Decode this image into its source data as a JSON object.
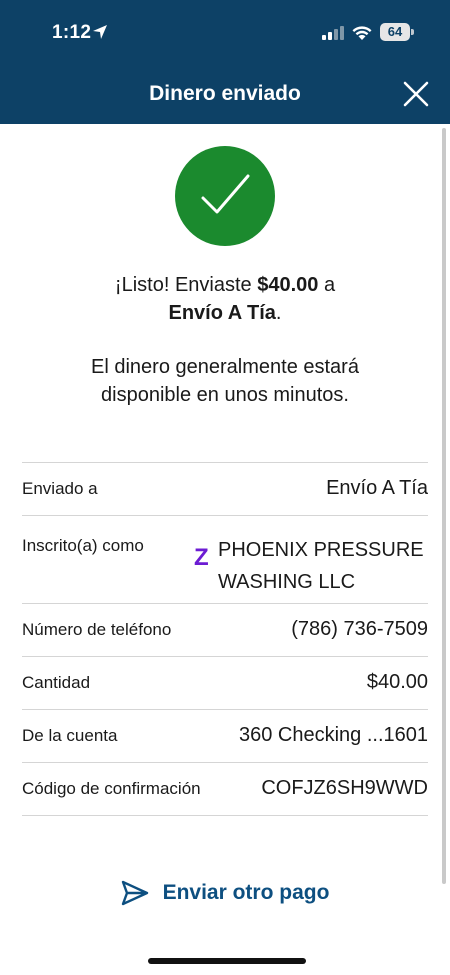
{
  "status_bar": {
    "time": "1:12",
    "battery": "64",
    "icons": [
      "location-arrow-icon",
      "signal-icon",
      "wifi-icon",
      "battery-icon"
    ]
  },
  "header": {
    "title": "Dinero enviado",
    "close_icon": "close-icon"
  },
  "confirmation": {
    "icon": "checkmark-icon",
    "line1_prefix": "¡Listo! Enviaste ",
    "amount": "$40.00",
    "line1_suffix": " a",
    "recipient": "Envío A Tía",
    "line2_suffix": ".",
    "availability": "El dinero generalmente estará disponible en unos minutos."
  },
  "details": {
    "sent_to_label": "Enviado a",
    "sent_to_value": "Envío A Tía",
    "enrolled_as_label": "Inscrito(a) como",
    "enrolled_as_value": "PHOENIX PRESSURE WASHING LLC",
    "enrolled_as_icon": "zelle-icon",
    "phone_label": "Número de teléfono",
    "phone_value": "(786) 736-7509",
    "amount_label": "Cantidad",
    "amount_value": "$40.00",
    "account_label": "De la cuenta",
    "account_value": "360 Checking ...1601",
    "confirmation_label": "Código de confirmación",
    "confirmation_value": "COFJZ6SH9WWD"
  },
  "actions": {
    "send_again_label": "Enviar otro pago",
    "send_again_icon": "send-icon"
  },
  "colors": {
    "header_bg": "#0d4166",
    "success_green": "#1b8a2e",
    "link_blue": "#0d4f80",
    "zelle_purple": "#6c1cd3"
  }
}
